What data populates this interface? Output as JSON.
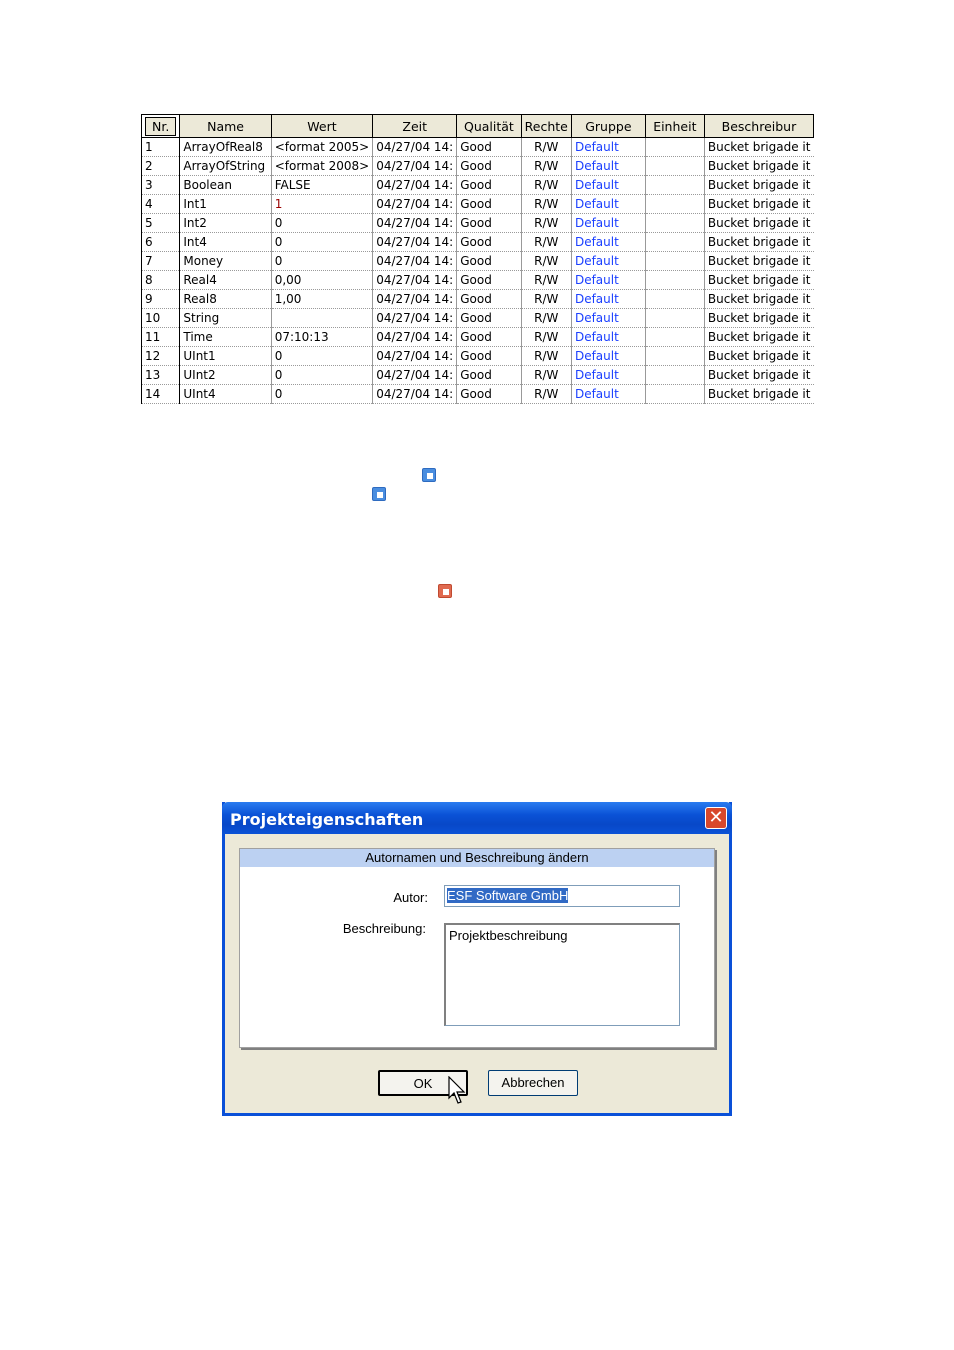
{
  "grid": {
    "columns": [
      "Nr.",
      "Name",
      "Wert",
      "Zeit",
      "Qualität",
      "Rechte",
      "Gruppe",
      "Einheit",
      "Beschreibur"
    ],
    "rows": [
      [
        "1",
        "ArrayOfReal8",
        "<format 2005>",
        "04/27/04 14:",
        "Good",
        "R/W",
        "Default",
        "",
        "Bucket brigade it"
      ],
      [
        "2",
        "ArrayOfString",
        "<format 2008>",
        "04/27/04 14:",
        "Good",
        "R/W",
        "Default",
        "",
        "Bucket brigade it"
      ],
      [
        "3",
        "Boolean",
        "FALSE",
        "04/27/04 14:",
        "Good",
        "R/W",
        "Default",
        "",
        "Bucket brigade it"
      ],
      [
        "4",
        "Int1",
        "1",
        "04/27/04 14:",
        "Good",
        "R/W",
        "Default",
        "",
        "Bucket brigade it"
      ],
      [
        "5",
        "Int2",
        "0",
        "04/27/04 14:",
        "Good",
        "R/W",
        "Default",
        "",
        "Bucket brigade it"
      ],
      [
        "6",
        "Int4",
        "0",
        "04/27/04 14:",
        "Good",
        "R/W",
        "Default",
        "",
        "Bucket brigade it"
      ],
      [
        "7",
        "Money",
        "0",
        "04/27/04 14:",
        "Good",
        "R/W",
        "Default",
        "",
        "Bucket brigade it"
      ],
      [
        "8",
        "Real4",
        "0,00",
        "04/27/04 14:",
        "Good",
        "R/W",
        "Default",
        "",
        "Bucket brigade it"
      ],
      [
        "9",
        "Real8",
        "1,00",
        "04/27/04 14:",
        "Good",
        "R/W",
        "Default",
        "",
        "Bucket brigade it"
      ],
      [
        "10",
        "String",
        "",
        "04/27/04 14:",
        "Good",
        "R/W",
        "Default",
        "",
        "Bucket brigade it"
      ],
      [
        "11",
        "Time",
        "07:10:13",
        "04/27/04 14:",
        "Good",
        "R/W",
        "Default",
        "",
        "Bucket brigade it"
      ],
      [
        "12",
        "UInt1",
        "0",
        "04/27/04 14:",
        "Good",
        "R/W",
        "Default",
        "",
        "Bucket brigade it"
      ],
      [
        "13",
        "UInt2",
        "0",
        "04/27/04 14:",
        "Good",
        "R/W",
        "Default",
        "",
        "Bucket brigade it"
      ],
      [
        "14",
        "UInt4",
        "0",
        "04/27/04 14:",
        "Good",
        "R/W",
        "Default",
        "",
        "Bucket brigade it"
      ]
    ],
    "group_link_color": "#1a3fff",
    "value_highlight_color": "#9a0000"
  },
  "icons": [
    "blue-square-icon",
    "blue-square-icon",
    "red-square-icon"
  ],
  "dialog": {
    "title": "Projekteigenschaften",
    "close_glyph": "✕",
    "panel_heading": "Autornamen und Beschreibung ändern",
    "autor_label": "Autor:",
    "autor_value": "ESF Software GmbH",
    "beschreibung_label": "Beschreibung:",
    "beschreibung_value": "Projektbeschreibung",
    "ok_label": "OK",
    "cancel_label": "Abbrechen",
    "titlebar_color": "#0a52d6",
    "selection_color": "#316ac5"
  }
}
